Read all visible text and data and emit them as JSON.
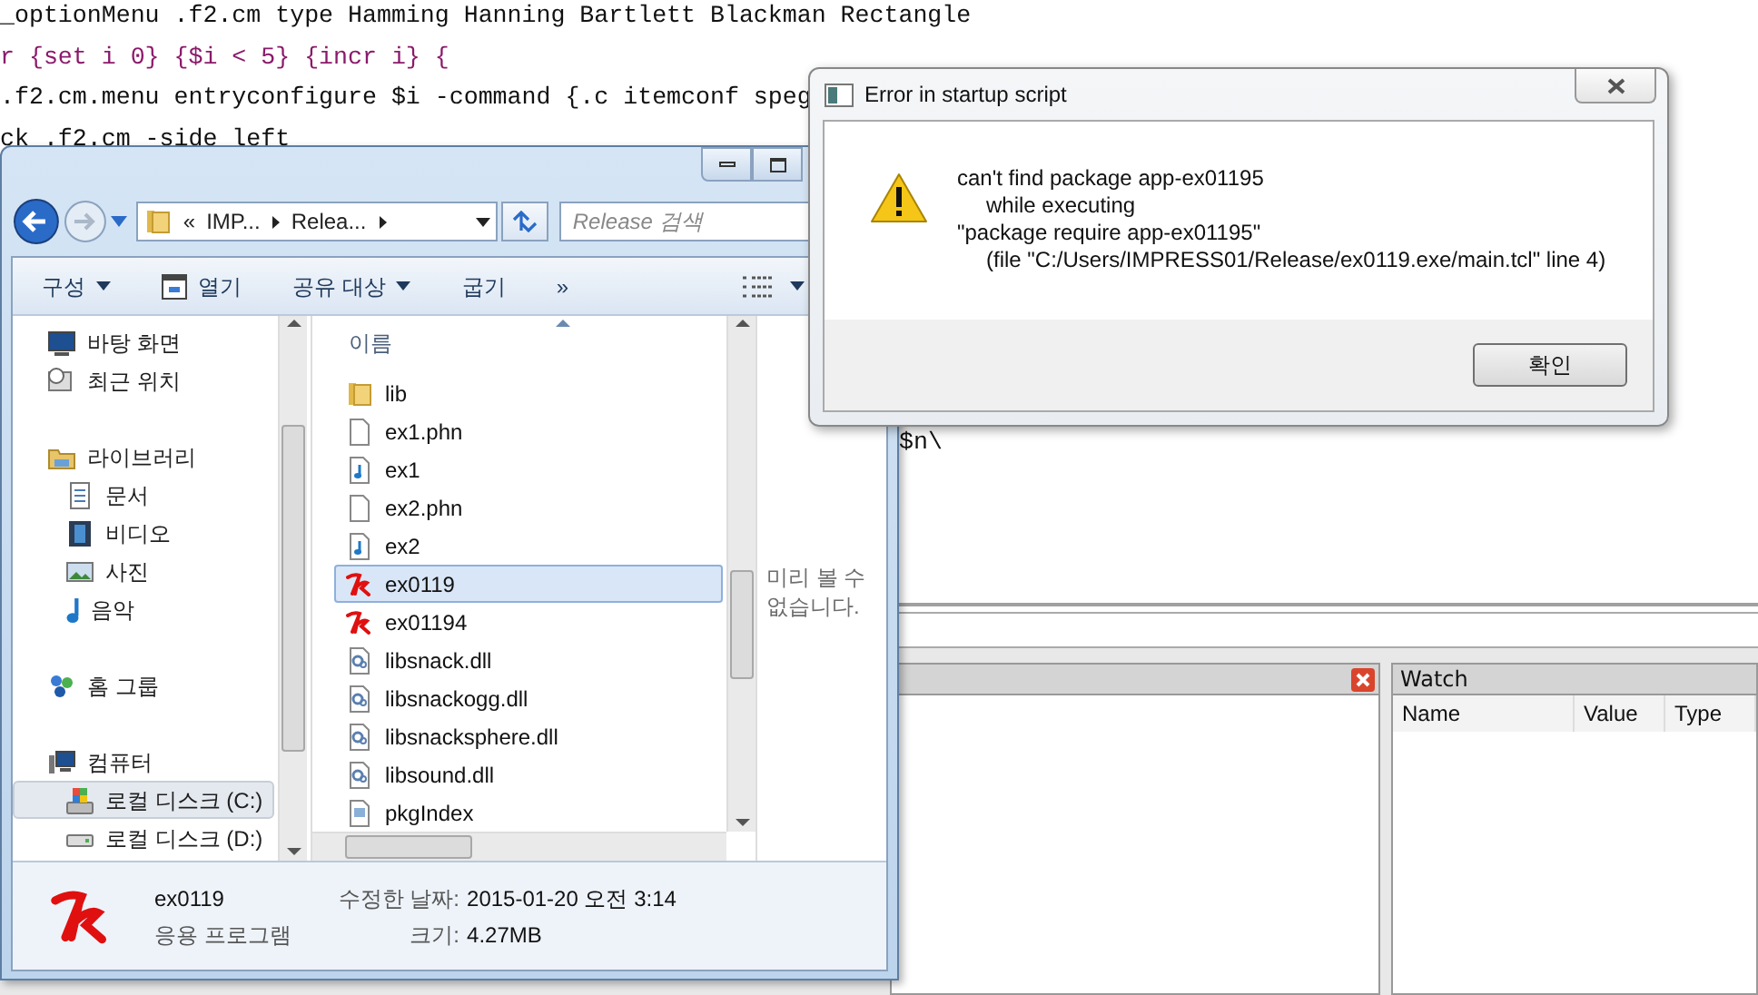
{
  "editor": {
    "lines": [
      {
        "text": "_optionMenu .f2.cm type Hamming Hanning Bartlett Blackman Rectangle",
        "kind": "plain"
      },
      {
        "text": "r {set i 0} {$i < 5} {incr i} {",
        "kind": "block"
      },
      {
        "text": ".f2.cm.menu entryconfigure $i -command {.c itemconf speg",
        "kind": "plain"
      },
      {
        "text": "ck .f2.cm -side left",
        "kind": "plain"
      },
      {
        "text": "$n\\",
        "kind": "plain"
      }
    ]
  },
  "explorer": {
    "address": {
      "overflow": "«",
      "crumbs": [
        "IMP...",
        "Relea..."
      ],
      "search_placeholder": "Release 검색"
    },
    "toolbar": [
      {
        "label": "구성",
        "kind": "menu"
      },
      {
        "label": "열기",
        "kind": "open"
      },
      {
        "label": "공유 대상",
        "kind": "menu"
      },
      {
        "label": "굽기",
        "kind": "plain"
      },
      {
        "label": "»",
        "kind": "plain"
      }
    ],
    "nav": [
      {
        "label": "바탕 화면",
        "kind": "desktop",
        "selected": false
      },
      {
        "label": "최근 위치",
        "kind": "recent",
        "selected": false
      },
      {
        "label": "라이브러리",
        "kind": "library",
        "selected": false,
        "children": [
          {
            "label": "문서",
            "kind": "document",
            "selected": false
          },
          {
            "label": "비디오",
            "kind": "video",
            "selected": false
          },
          {
            "label": "사진",
            "kind": "picture",
            "selected": false
          },
          {
            "label": "음악",
            "kind": "music",
            "selected": false
          }
        ]
      },
      {
        "label": "홈 그룹",
        "kind": "homegroup",
        "selected": false
      },
      {
        "label": "컴퓨터",
        "kind": "computer",
        "selected": false,
        "children": [
          {
            "label": "로컬 디스크 (C:)",
            "kind": "systemdisk",
            "selected": true
          },
          {
            "label": "로컬 디스크 (D:)",
            "kind": "disk",
            "selected": false
          }
        ]
      }
    ],
    "column": "이름",
    "files": [
      {
        "name": "lib",
        "kind": "folder",
        "selected": false
      },
      {
        "name": "ex1.phn",
        "kind": "blank",
        "selected": false
      },
      {
        "name": "ex1",
        "kind": "audio",
        "selected": false
      },
      {
        "name": "ex2.phn",
        "kind": "blank",
        "selected": false
      },
      {
        "name": "ex2",
        "kind": "audio",
        "selected": false
      },
      {
        "name": "ex0119",
        "kind": "tk",
        "selected": true
      },
      {
        "name": "ex01194",
        "kind": "tk",
        "selected": false
      },
      {
        "name": "libsnack.dll",
        "kind": "dll",
        "selected": false
      },
      {
        "name": "libsnackogg.dll",
        "kind": "dll",
        "selected": false
      },
      {
        "name": "libsnacksphere.dll",
        "kind": "dll",
        "selected": false
      },
      {
        "name": "libsound.dll",
        "kind": "dll",
        "selected": false
      },
      {
        "name": "pkgIndex",
        "kind": "script",
        "selected": false
      }
    ],
    "preview": "미리 볼 수 없습니다.",
    "details": {
      "name": "ex0119",
      "type": "응용 프로그램",
      "modified_label": "수정한 날짜:",
      "modified": "2015-01-20 오전 3:14",
      "size_label": "크기:",
      "size": "4.27MB"
    }
  },
  "dialog": {
    "title": "Error in startup script",
    "lines": [
      {
        "text": "can't find package app-ex01195",
        "indented": false
      },
      {
        "text": "while executing",
        "indented": true
      },
      {
        "text": "\"package require app-ex01195\"",
        "indented": false
      },
      {
        "text": "(file \"C:/Users/IMPRESS01/Release/ex0119.exe/main.tcl\" line 4)",
        "indented": true
      }
    ],
    "button": "확인"
  },
  "watch": {
    "title": "Watch",
    "columns": [
      "Name",
      "Value",
      "Type"
    ]
  }
}
